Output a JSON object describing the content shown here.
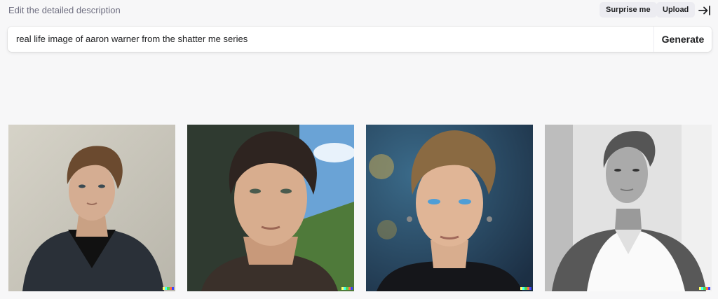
{
  "header": {
    "hint": "Edit the detailed description",
    "surprise_label": "Surprise me",
    "upload_label": "Upload",
    "collapse_icon": "arrow-right-to-bar-icon"
  },
  "prompt": {
    "text": "real life image of aaron warner from the shatter me series",
    "generate_label": "Generate"
  },
  "results": {
    "images": [
      {
        "name": "result-image-1",
        "style": "photo"
      },
      {
        "name": "result-image-2",
        "style": "painting"
      },
      {
        "name": "result-image-3",
        "style": "3d-render"
      },
      {
        "name": "result-image-4",
        "style": "black-and-white-photo"
      }
    ],
    "watermark_colors": [
      "#ffff66",
      "#42ffff",
      "#51da4c",
      "#ff6e3c",
      "#3c46ff"
    ]
  }
}
